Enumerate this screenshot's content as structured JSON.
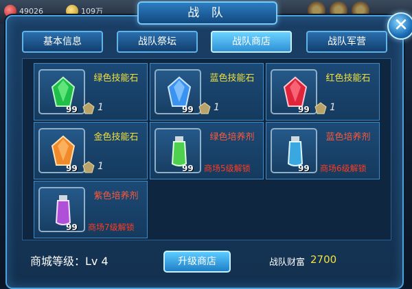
{
  "resources": {
    "r1": "49026",
    "r2": "109万"
  },
  "title": "战 队",
  "close_label": "✕",
  "tabs": [
    {
      "label": "基本信息"
    },
    {
      "label": "战队祭坛"
    },
    {
      "label": "战队商店"
    },
    {
      "label": "战队军营"
    }
  ],
  "items": [
    {
      "name": "绿色技能石",
      "qty": "99",
      "level": "1"
    },
    {
      "name": "蓝色技能石",
      "qty": "99",
      "level": "1"
    },
    {
      "name": "红色技能石",
      "qty": "99",
      "level": "1"
    },
    {
      "name": "金色技能石",
      "qty": "99",
      "level": "1"
    },
    {
      "name": "绿色培养剂",
      "qty": "99",
      "unlock": "商场5级解锁"
    },
    {
      "name": "蓝色培养剂",
      "qty": "99",
      "unlock": "商场6级解锁"
    },
    {
      "name": "紫色培养剂",
      "qty": "99",
      "unlock": "商场7级解锁"
    }
  ],
  "footer": {
    "shop_level_label": "商城等级：Lv 4",
    "upgrade_label": "升级商店",
    "wealth_label": "战队财富",
    "wealth_value": "2700"
  },
  "colors": {
    "accent": "#4fa3dc",
    "gold_text": "#f5e23a",
    "red_text": "#ff3b1f"
  }
}
